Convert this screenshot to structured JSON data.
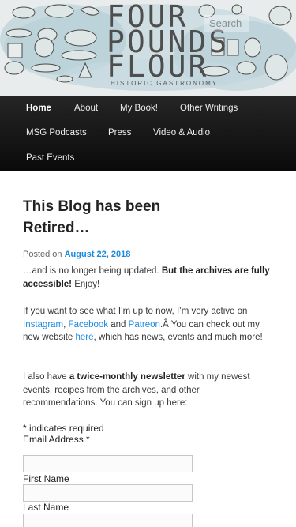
{
  "header": {
    "brand_line1": "FOUR",
    "brand_line2": "POUNDS",
    "brand_line3": "FLOUR",
    "tagline": "HISTORIC GASTRONOMY",
    "search_placeholder": "Search",
    "banner_color": "#b9d3db"
  },
  "nav": {
    "items": [
      {
        "label": "Home",
        "active": true
      },
      {
        "label": "About"
      },
      {
        "label": "My Book!"
      },
      {
        "label": "Other Writings"
      },
      {
        "label": "MSG Podcasts"
      },
      {
        "label": "Press"
      },
      {
        "label": "Video & Audio"
      },
      {
        "label": "Past Events"
      }
    ]
  },
  "post": {
    "title": "This Blog has been Retired…",
    "posted_on_prefix": "Posted on",
    "date": "August 22, 2018",
    "p1_a": "…and is no longer being updated.",
    "p1_bold": "But the archives are fully accessible!",
    "p1_b": "Enjoy!",
    "p2_a": "If you want to see what I’m up to now, I’m very active on",
    "link_instagram": "Instagram",
    "p2_comma": ",",
    "link_facebook": "Facebook",
    "p2_and": "and",
    "link_patreon": "Patreon",
    "p2_b": ".Â You can check out my new website",
    "link_here": "here",
    "p2_c": ", which has news, events and much more!",
    "p3_a": "I also have",
    "p3_bold": "a twice-monthly newsletter",
    "p3_b": "with my newest events, recipes from the archives, and other recommendations. You can sign up here:"
  },
  "form": {
    "required_note": "* indicates required",
    "email_label": "Email Address *",
    "first_name_label": "First Name",
    "last_name_label": "Last Name"
  },
  "colors": {
    "link": "#1b8be0",
    "nav_bg": "#151515"
  }
}
